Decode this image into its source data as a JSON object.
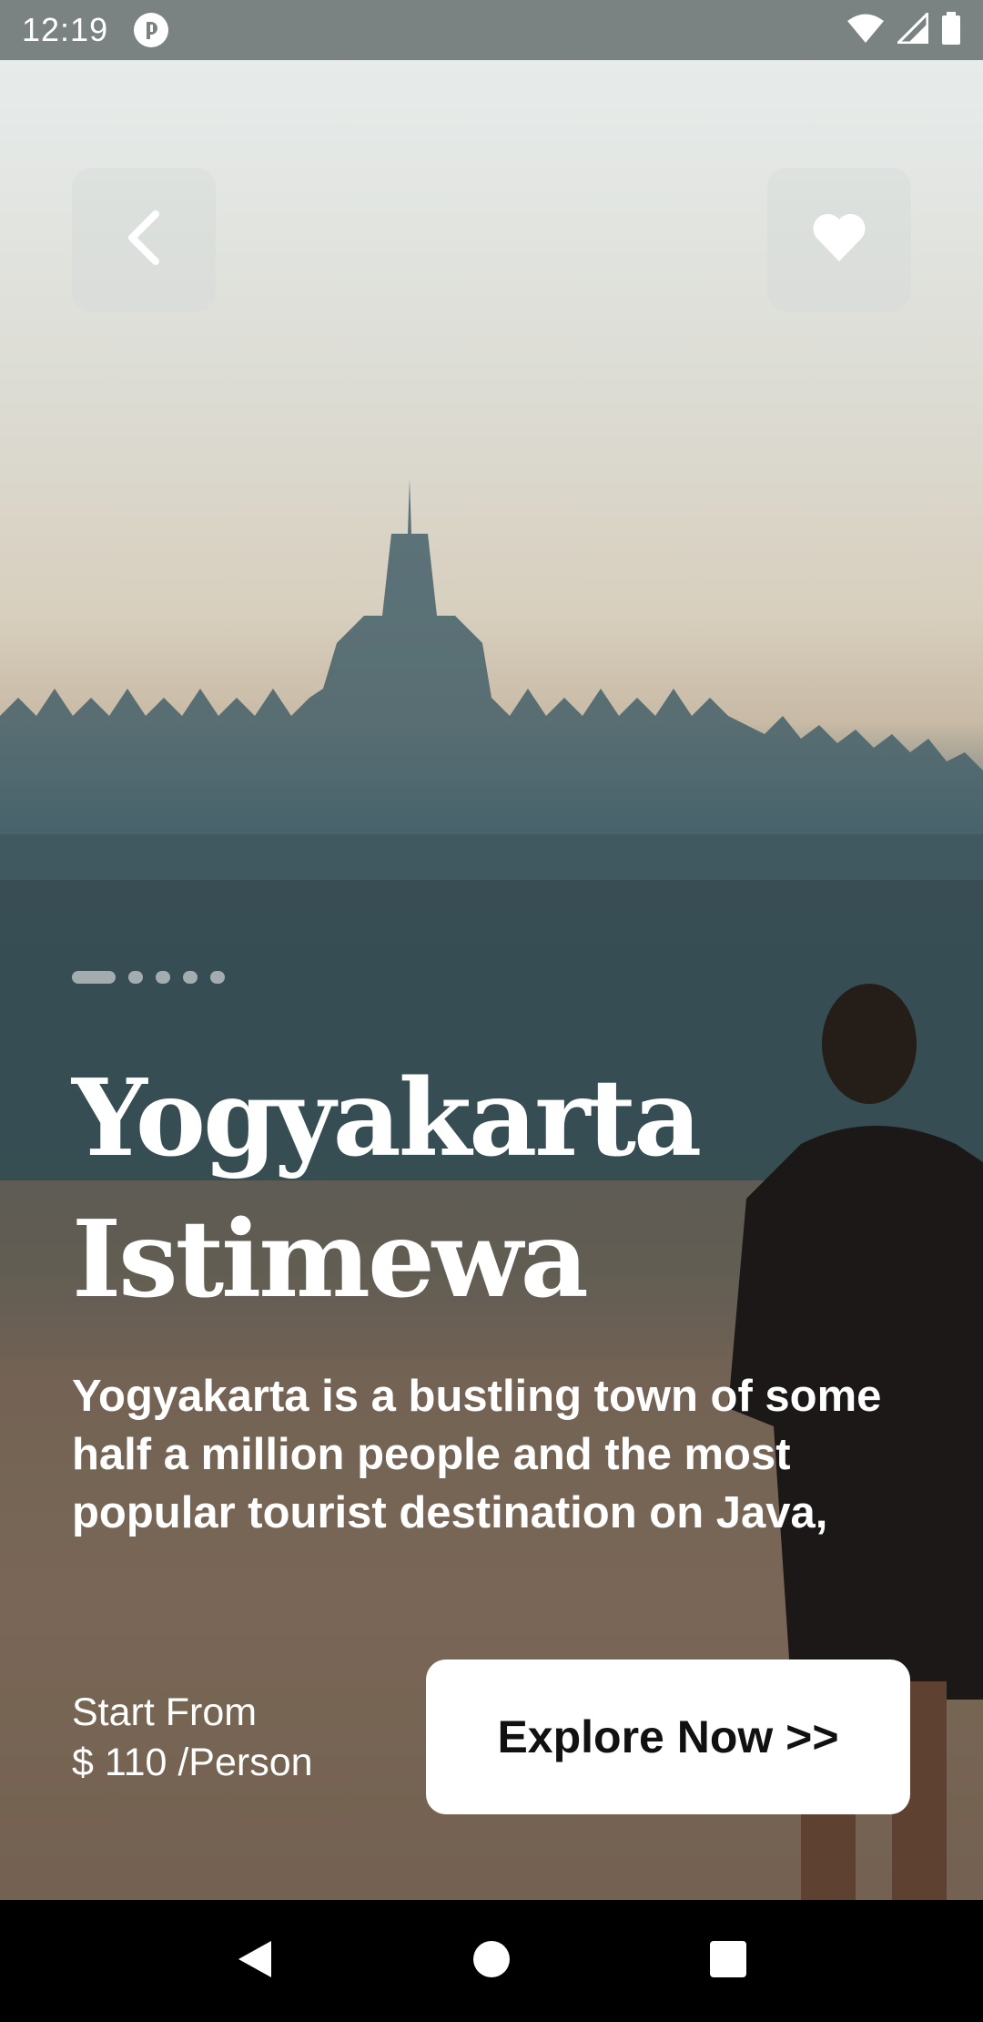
{
  "status_bar": {
    "time": "12:19",
    "app_icon": "notification-app-icon",
    "icons": [
      "wifi-icon",
      "signal-icon",
      "battery-icon"
    ]
  },
  "top_buttons": {
    "back_icon": "chevron-left-icon",
    "favorite_icon": "heart-icon"
  },
  "carousel": {
    "total": 5,
    "active_index": 0
  },
  "destination": {
    "title_line1": "Yogyakarta",
    "title_line2": "Istimewa",
    "description_line1": "Yogyakarta is a bustling town of some",
    "description_line2": "half a million people and the most",
    "description_line3": "popular tourist destination on Java,"
  },
  "pricing": {
    "label": "Start From",
    "price": "$ 110 /Person"
  },
  "cta": {
    "label": "Explore Now >>"
  },
  "nav_bar": {
    "icons": [
      "back-triangle-icon",
      "home-circle-icon",
      "recents-square-icon"
    ]
  },
  "colors": {
    "button_bg": "#ffffff",
    "text": "#ffffff",
    "cta_text": "#111111"
  }
}
